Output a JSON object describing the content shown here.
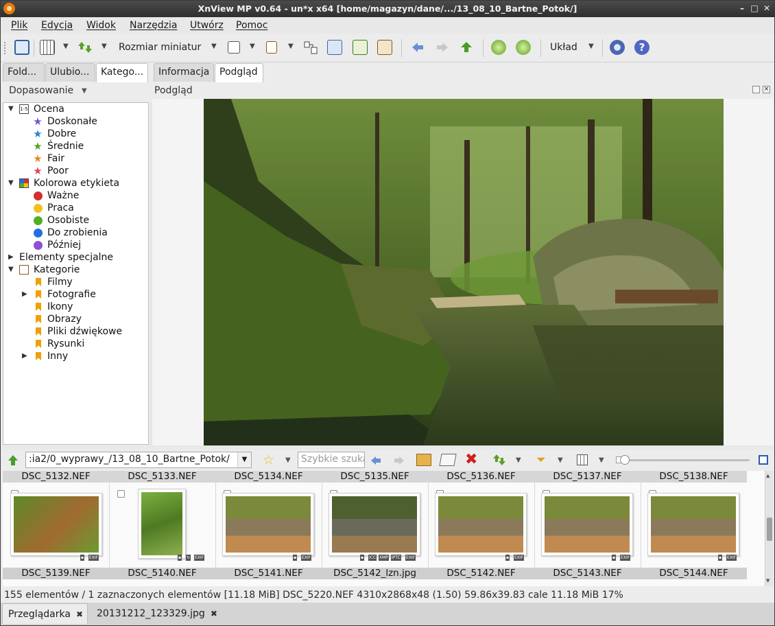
{
  "window": {
    "title": "XnView MP v0.64 - un*x x64 [home/magazyn/dane/.../13_08_10_Bartne_Potok/]"
  },
  "menu": [
    "Plik",
    "Edycja",
    "Widok",
    "Narzędzia",
    "Utwórz",
    "Pomoc"
  ],
  "toolbar": {
    "thumb_size_label": "Rozmiar miniatur",
    "layout_label": "Układ"
  },
  "left_tabs": [
    "Fold...",
    "Ulubio...",
    "Katego..."
  ],
  "right_tabs": [
    "Informacja",
    "Podgląd"
  ],
  "left_panel": {
    "filter_label": "Dopasowanie"
  },
  "preview_panel": {
    "title": "Podgląd"
  },
  "tree": {
    "rating": {
      "label": "Ocena",
      "items": [
        "Doskonałe",
        "Dobre",
        "Średnie",
        "Fair",
        "Poor"
      ]
    },
    "color_label": {
      "label": "Kolorowa etykieta",
      "items": [
        "Ważne",
        "Praca",
        "Osobiste",
        "Do zrobienia",
        "Później"
      ]
    },
    "special": {
      "label": "Elementy specjalne"
    },
    "categories": {
      "label": "Kategorie",
      "items": [
        "Filmy",
        "Fotografie",
        "Ikony",
        "Obrazy",
        "Pliki dźwiękowe",
        "Rysunki",
        "Inny"
      ]
    }
  },
  "colors": {
    "star_colors": [
      "#7a4fd0",
      "#2a7fd4",
      "#55a020",
      "#e08a1e",
      "#d24a5a"
    ],
    "label_colors": [
      "#d03030",
      "#f0c020",
      "#50b020",
      "#2070e0",
      "#9050d0"
    ]
  },
  "browser": {
    "path": ":ia2/0_wyprawy_/13_08_10_Bartne_Potok/",
    "quick_search_placeholder": "Szybkie szukanie"
  },
  "thumbnails": {
    "top_row_names": [
      "DSC_5132.NEF",
      "DSC_5133.NEF",
      "DSC_5134.NEF",
      "DSC_5135.NEF",
      "DSC_5136.NEF",
      "DSC_5137.NEF",
      "DSC_5138.NEF"
    ],
    "bottom_row_names": [
      "DSC_5139.NEF",
      "DSC_5140.NEF",
      "DSC_5141.NEF",
      "DSC_5142_lzn.jpg",
      "DSC_5142.NEF",
      "DSC_5143.NEF",
      "DSC_5144.NEF"
    ],
    "badges": {
      "exif": "EXIF",
      "icc": "ICC",
      "xmp": "XMP",
      "iptc": "IPTC"
    }
  },
  "status": "155 elementów / 1 zaznaczonych elementów [11.18 MiB]  DSC_5220.NEF  4310x2868x48 (1.50)  59.86x39.83 cale  11.18 MiB  17%",
  "bottom_tabs": [
    "Przeglądarka",
    "20131212_123329.jpg"
  ],
  "tab_close_glyph": "✖",
  "window_buttons": [
    "–",
    "□",
    "✕"
  ]
}
